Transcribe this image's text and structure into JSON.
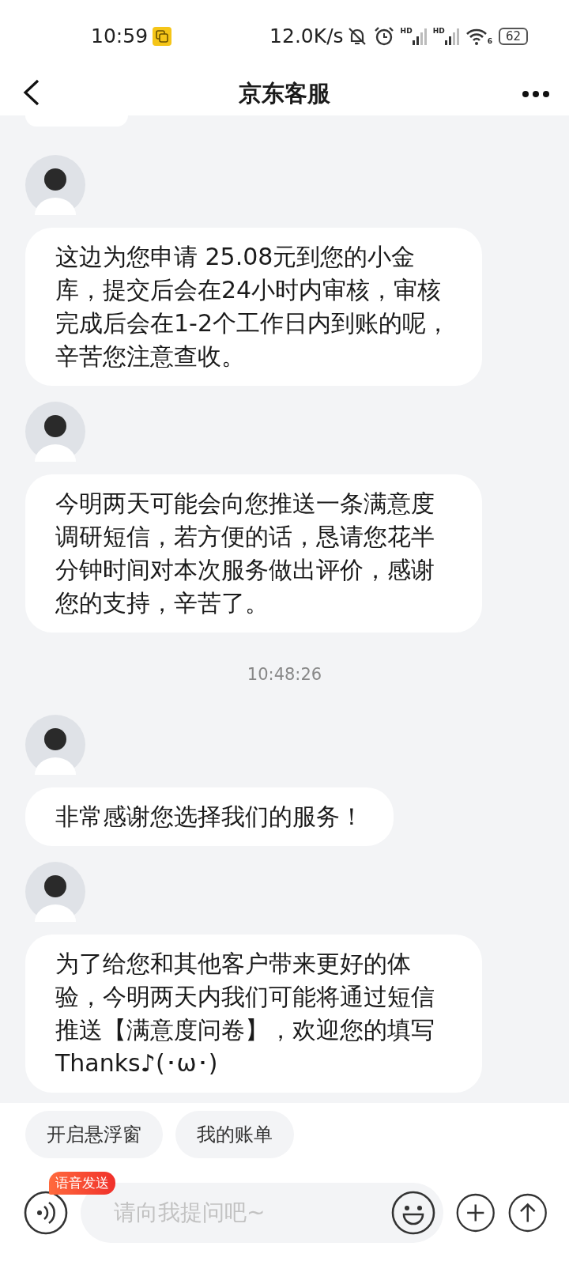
{
  "status_bar": {
    "time": "10:59",
    "speed": "12.0K/s",
    "signals": [
      {
        "label": "HD"
      },
      {
        "label": "HD"
      }
    ],
    "wifi_label": "6",
    "battery": "62"
  },
  "header": {
    "title": "京东客服"
  },
  "messages": [
    {
      "kind": "message",
      "text": "这边为您申请 25.08元到您的小金库，提交后会在24小时内审核，审核完成后会在1-2个工作日内到账的呢，辛苦您注意查收。"
    },
    {
      "kind": "message",
      "text": "今明两天可能会向您推送一条满意度调研短信，若方便的话，恳请您花半分钟时间对本次服务做出评价，感谢您的支持，辛苦了。"
    },
    {
      "kind": "time",
      "text": "10:48:26"
    },
    {
      "kind": "message",
      "text": "非常感谢您选择我们的服务！"
    },
    {
      "kind": "message",
      "text": "为了给您和其他客户带来更好的体验，今明两天内我们可能将通过短信推送【满意度问卷】，欢迎您的填写Thanks♪(･ω･)"
    }
  ],
  "quick_replies": [
    "开启悬浮窗",
    "我的账单"
  ],
  "input": {
    "badge": "语音发送",
    "placeholder": "请向我提问吧~"
  }
}
